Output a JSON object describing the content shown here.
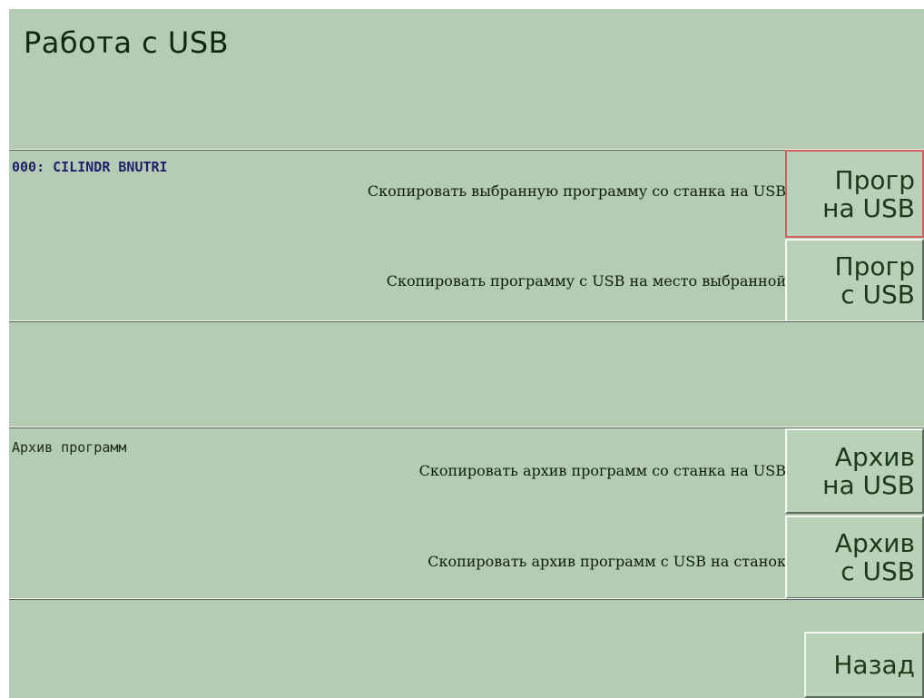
{
  "screen": {
    "title": "Работа с USB"
  },
  "program_section": {
    "title": "000: CILINDR BNUTRI",
    "rows": [
      {
        "description": "Скопировать выбранную программу со станка на USB",
        "button_line1": "Прогр",
        "button_line2": "на USB",
        "selected": true
      },
      {
        "description": "Скопировать программу с USB на место выбранной",
        "button_line1": "Прогр",
        "button_line2": "с USB",
        "selected": false
      }
    ]
  },
  "archive_section": {
    "title": "Архив программ",
    "rows": [
      {
        "description": "Скопировать архив программ со станка на USB",
        "button_line1": "Архив",
        "button_line2": "на USB"
      },
      {
        "description": "Скопировать архив программ с USB на станок",
        "button_line1": "Архив",
        "button_line2": "с USB"
      }
    ]
  },
  "footer": {
    "back_label": "Назад"
  },
  "colors": {
    "background": "#b4ccb4",
    "text_dark": "#0e2a0e",
    "program_title": "#1f1f6a",
    "selected_border": "#d06060"
  }
}
